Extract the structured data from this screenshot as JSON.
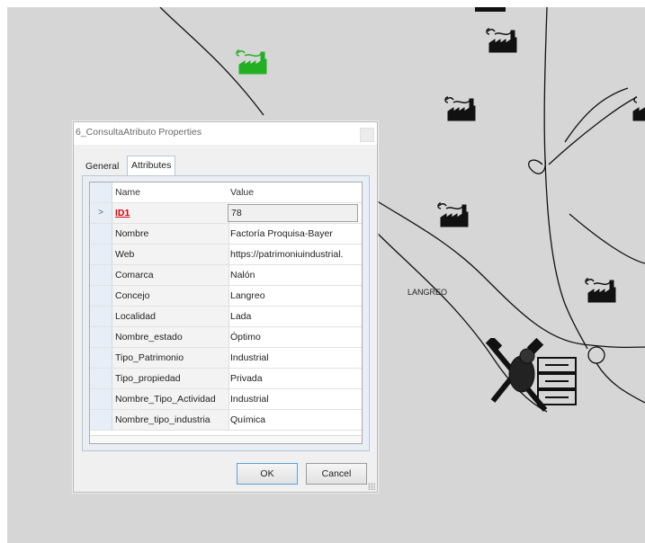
{
  "map": {
    "place_label": "LANGREO"
  },
  "dialog": {
    "title": "6_ConsultaAtributo Properties",
    "tabs": [
      "General",
      "Attributes"
    ],
    "active_tab": "Attributes",
    "columns": {
      "name": "Name",
      "value": "Value"
    },
    "selected_row_marker": ">",
    "rows": [
      {
        "name": "ID1",
        "value": "78"
      },
      {
        "name": "Nombre",
        "value": "Factoría Proquisa-Bayer"
      },
      {
        "name": "Web",
        "value": "https://patrimoniuindustrial."
      },
      {
        "name": "Comarca",
        "value": "Nalón"
      },
      {
        "name": "Concejo",
        "value": "Langreo"
      },
      {
        "name": "Localidad",
        "value": "Lada"
      },
      {
        "name": "Nombre_estado",
        "value": "Óptimo"
      },
      {
        "name": "Tipo_Patrimonio",
        "value": "Industrial"
      },
      {
        "name": "Tipo_propiedad",
        "value": "Privada"
      },
      {
        "name": "Nombre_Tipo_Actividad",
        "value": "Industrial"
      },
      {
        "name": "Nombre_tipo_industria",
        "value": "Química"
      }
    ],
    "ok_label": "OK",
    "cancel_label": "Cancel"
  },
  "icons": {
    "factory": "factory-icon",
    "selected_factory": "factory-icon-green",
    "mining": "mining-heritage-icon",
    "close": "close-icon"
  },
  "colors": {
    "map_background": "#d6d6d6",
    "selected_factory": "#22b022",
    "id_field": "#d8000c"
  }
}
